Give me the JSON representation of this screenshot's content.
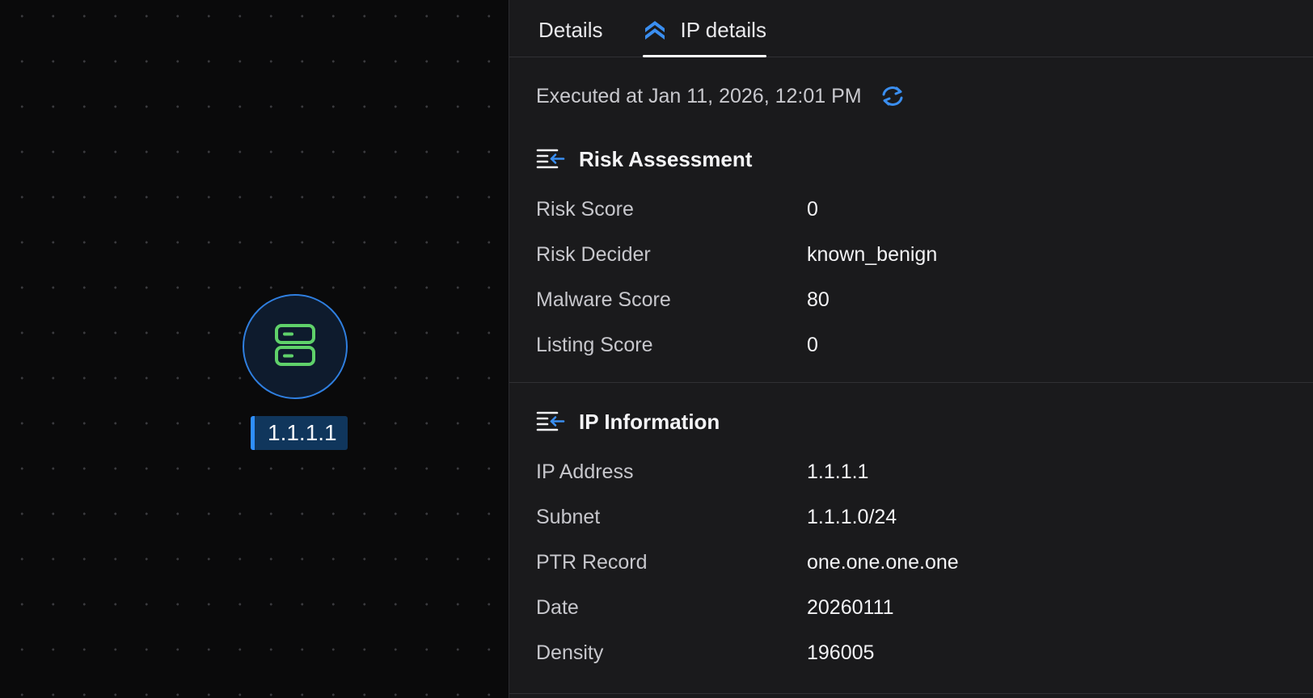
{
  "colors": {
    "accent": "#2f7fe0",
    "node_icon": "#5fd16a",
    "refresh": "#3a8ef0"
  },
  "canvas": {
    "node": {
      "icon": "server-icon",
      "label": "1.1.1.1"
    }
  },
  "tabs": [
    {
      "label": "Details",
      "active": false
    },
    {
      "label": "IP details",
      "active": true,
      "icon": "chevron-double-up-icon"
    }
  ],
  "executed_at": "Executed at Jan 11, 2026, 12:01 PM",
  "sections": {
    "risk": {
      "title": "Risk Assessment",
      "icon": "list-arrow-icon",
      "rows": [
        {
          "key": "Risk Score",
          "value": "0"
        },
        {
          "key": "Risk Decider",
          "value": "known_benign"
        },
        {
          "key": "Malware Score",
          "value": "80"
        },
        {
          "key": "Listing Score",
          "value": "0"
        }
      ]
    },
    "ip": {
      "title": "IP Information",
      "icon": "list-arrow-icon",
      "rows": [
        {
          "key": "IP Address",
          "value": "1.1.1.1"
        },
        {
          "key": "Subnet",
          "value": "1.1.1.0/24"
        },
        {
          "key": "PTR Record",
          "value": "one.one.one.one"
        },
        {
          "key": "Date",
          "value": "20260111"
        },
        {
          "key": "Density",
          "value": "196005"
        }
      ]
    }
  }
}
